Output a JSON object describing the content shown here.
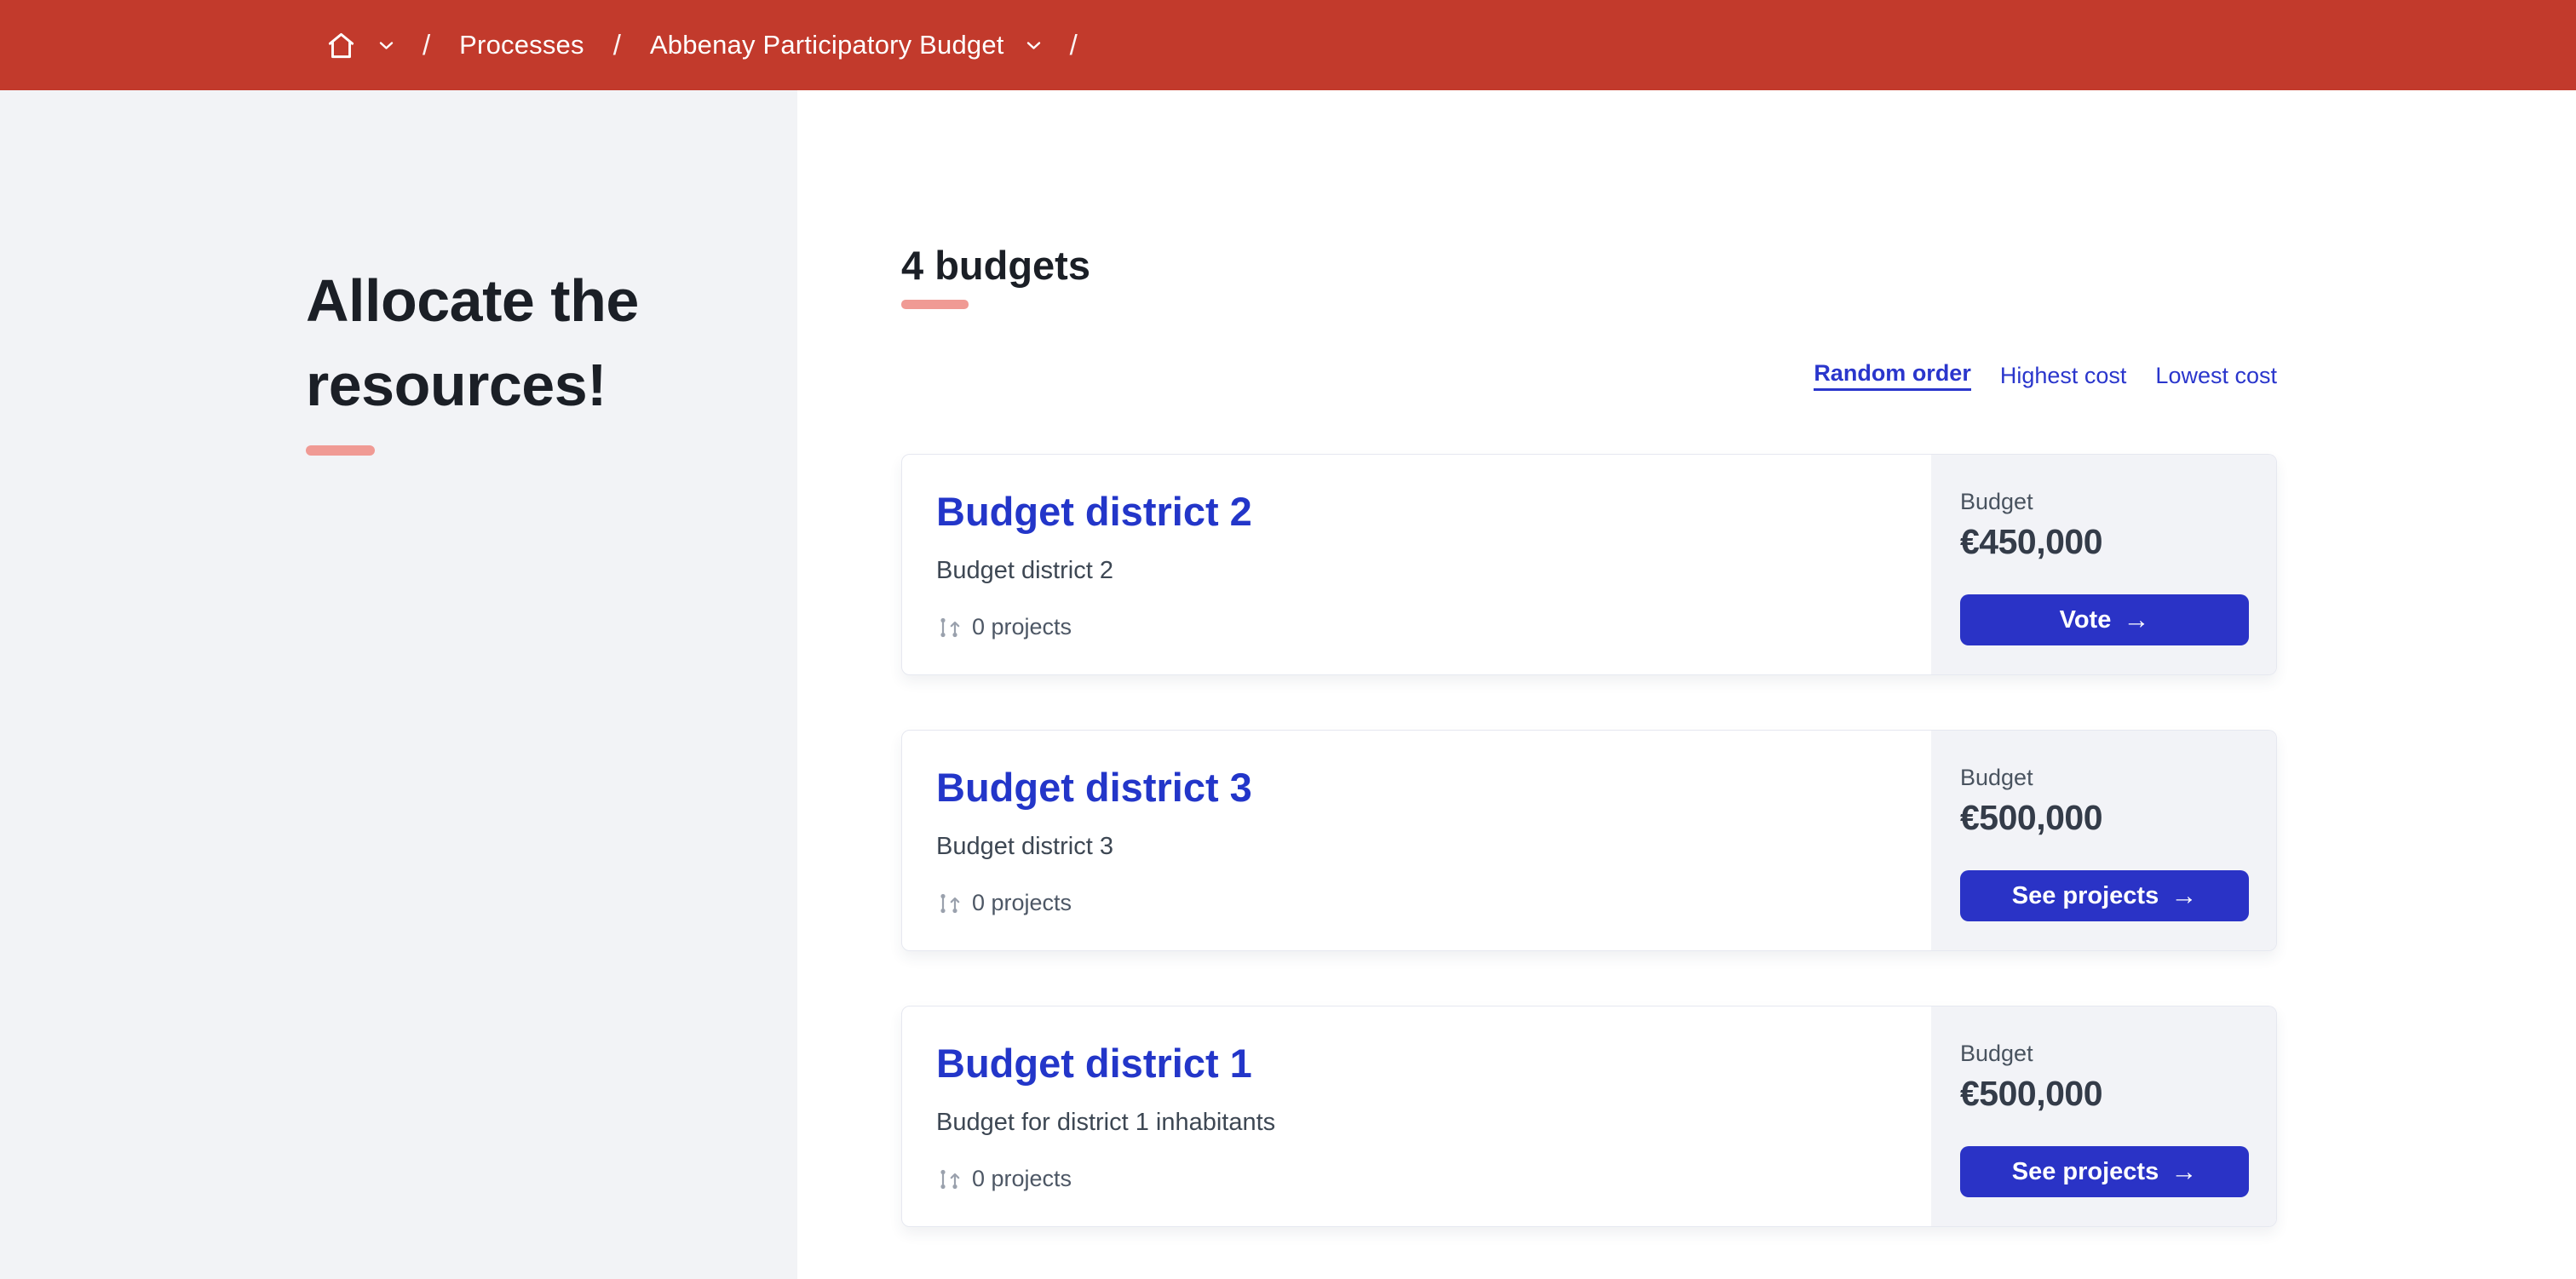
{
  "header": {
    "breadcrumb": {
      "separator": "/",
      "processes_label": "Processes",
      "process_title": "Abbenay Participatory Budget"
    }
  },
  "sidebar": {
    "title": "Allocate the resources!"
  },
  "main": {
    "count_heading": "4 budgets",
    "sort": [
      {
        "label": "Random order",
        "active": true
      },
      {
        "label": "Highest cost",
        "active": false
      },
      {
        "label": "Lowest cost",
        "active": false
      }
    ],
    "budgets": [
      {
        "title": "Budget district 2",
        "description": "Budget district 2",
        "projects": "0 projects",
        "budget_label": "Budget",
        "amount": "€450,000",
        "cta": "Vote"
      },
      {
        "title": "Budget district 3",
        "description": "Budget district 3",
        "projects": "0 projects",
        "budget_label": "Budget",
        "amount": "€500,000",
        "cta": "See projects"
      },
      {
        "title": "Budget district 1",
        "description": "Budget for district 1 inhabitants",
        "projects": "0 projects",
        "budget_label": "Budget",
        "amount": "€500,000",
        "cta": "See projects"
      }
    ]
  },
  "icons": {
    "arrow_right": "→"
  },
  "theme": {
    "header_red": "#c23a2c",
    "primary_blue": "#2a33c6",
    "link_blue": "#2336c9",
    "underline_pink": "#f09a94",
    "sidebar_bg": "#f2f3f6",
    "aside_bg": "#f2f3f7"
  }
}
